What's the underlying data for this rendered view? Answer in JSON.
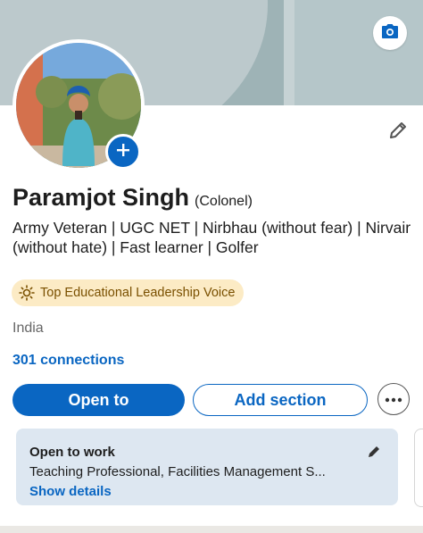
{
  "profile": {
    "name": "Paramjot Singh",
    "suffix": "(Colonel)",
    "headline": "Army Veteran | UGC NET | Nirbhau (without fear) | Nirvair (without hate) | Fast learner | Golfer",
    "badge": "Top Educational Leadership Voice",
    "location": "India",
    "connections": "301 connections"
  },
  "actions": {
    "open_to": "Open to",
    "add_section": "Add section"
  },
  "open_to_work": {
    "title": "Open to work",
    "roles": "Teaching Professional, Facilities Management S...",
    "link": "Show details"
  },
  "icons": {
    "cover_edit": "camera-icon",
    "add_photo": "plus-icon",
    "edit_intro": "pencil-icon",
    "badge": "sun-icon",
    "more": "more-horizontal-icon",
    "card_edit": "pencil-icon"
  },
  "colors": {
    "accent": "#0a66c2",
    "badge_bg": "#fcebc5",
    "card_bg": "#dde7f1"
  }
}
